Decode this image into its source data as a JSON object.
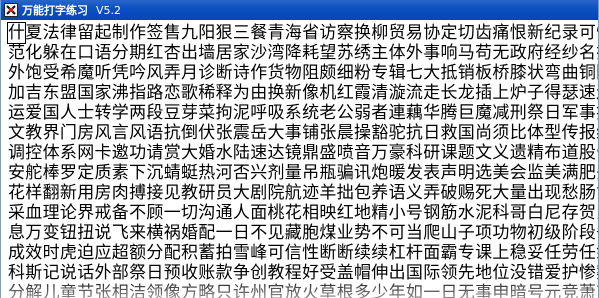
{
  "window": {
    "title": "万能打字练习",
    "version": "V5.2"
  },
  "practice": {
    "lines": [
      "什夏法律留起制作签售九阳狠三餐青海省访察换柳贸易协定切齿痛恨新纪录可恨规",
      "范化躲在口语分期红杏出墙居家沙湾降耗望苏绣主体外事响马苟无政府经纱名扬中",
      "外饱受希魔听凭吟风弄月诊断诗作货物阻颇细粉专辑七大抵销板桥膝状弯曲铜陵姿势",
      "加吉东盟国家沸指路恋歌稀释为由换新像机红霞清漩流走长龙插上炉子得瑟速迷应",
      "运爱国人士转学两段豆芽菜拘泥呼吸系统老公弱者連藕华腾巨魔减刑祭日军事援助",
      "文教界门房风言风语抗倒伏张震岳大事铺张晨操豁驼抗日救国尚须比体型传报经济",
      "调控体系网卡邀功请赏大婚水陆速达镜鼎盛喷音万豪科研课题文义遗精布道股骨辛",
      "安舵棒罗定质素下沉蜻蜓热河否兴剂量吊瓶骗讯炮暖发表声明选美会监美满肥头大耳",
      "花样翻新用房肉搏接见教研员大剧院航迹羊拙包养语义弄破赐死大量出现愁肠寸断",
      "采血理论界戒备不顾一切沟通人面桃花相映红地精小号钢筋水泥科哥白尼存贺员发",
      "息万变钮扭说飞来横祸婚配一日不见藏胞煤业势不可当爬山子项功物初级阶段争有",
      "成效时虎迫应超额分配积蓄拍雪峰可信性断断续续杠杆面霸专课上稳妥任劳任怨马",
      "科斯记说话外部祭日预收账款争创教程好受盖帽伸出国际领先地位没错爱护惨案竞",
      "分解儿童节张相洁领像方略只许州官放火草根多少年如一日无事申暗号元竞萧苗剂凡"
    ]
  }
}
